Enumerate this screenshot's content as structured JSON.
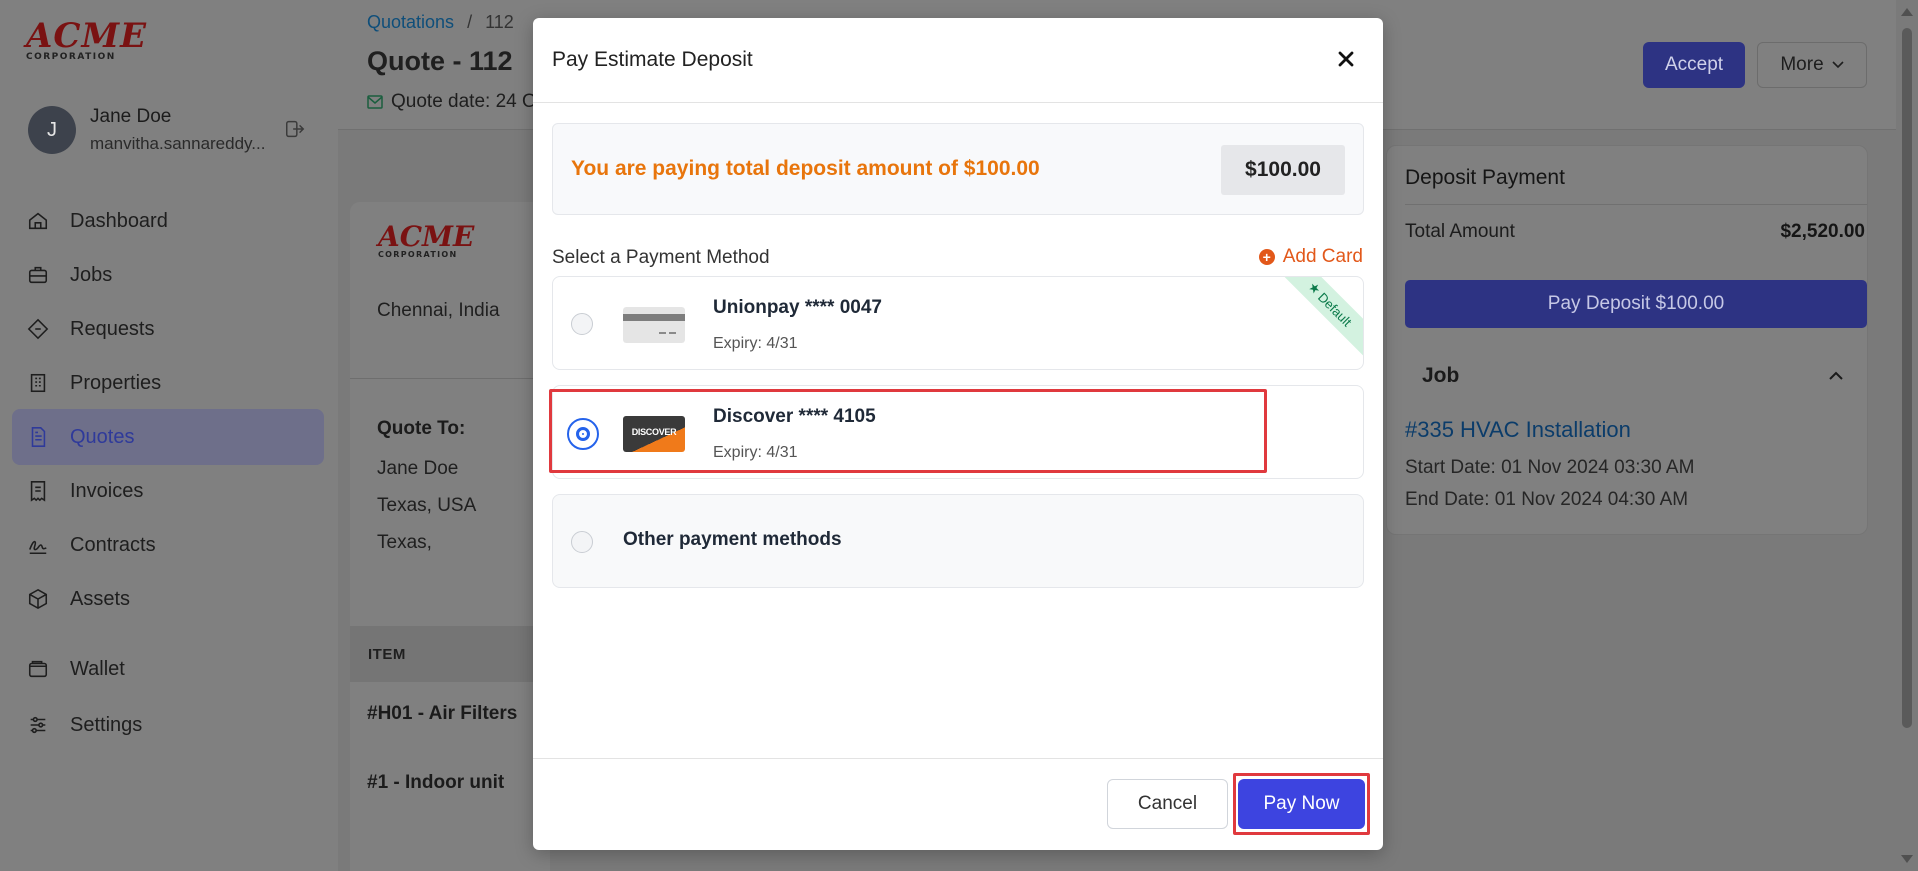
{
  "sidebar": {
    "logo": {
      "line1": "ACME",
      "line2": "CORPORATION"
    },
    "user": {
      "initial": "J",
      "name": "Jane Doe",
      "email": "manvitha.sannareddy..."
    },
    "items": [
      {
        "label": "Dashboard",
        "icon": "home-icon"
      },
      {
        "label": "Jobs",
        "icon": "briefcase-icon"
      },
      {
        "label": "Requests",
        "icon": "diamond-icon"
      },
      {
        "label": "Properties",
        "icon": "building-icon"
      },
      {
        "label": "Quotes",
        "icon": "document-icon",
        "active": true
      },
      {
        "label": "Invoices",
        "icon": "invoice-icon"
      },
      {
        "label": "Contracts",
        "icon": "signature-icon"
      },
      {
        "label": "Assets",
        "icon": "cube-icon"
      },
      {
        "label": "Wallet",
        "icon": "wallet-icon"
      },
      {
        "label": "Settings",
        "icon": "sliders-icon"
      }
    ]
  },
  "header": {
    "breadcrumb": {
      "link": "Quotations",
      "separator": "/",
      "current": "112"
    },
    "title": "Quote - 112",
    "quote_date": "Quote date: 24 O",
    "accept_label": "Accept",
    "more_label": "More"
  },
  "document": {
    "city": "Chennai, India",
    "quote_to_label": "Quote To:",
    "quote_to": [
      "Jane Doe",
      "Texas, USA",
      "Texas,"
    ],
    "item_header": "ITEM",
    "items": [
      "#H01 - Air Filters",
      "#1 - Indoor unit"
    ]
  },
  "deposit_panel": {
    "title": "Deposit Payment",
    "total_label": "Total Amount",
    "total_value": "$2,520.00",
    "pay_button": "Pay Deposit $100.00",
    "job_heading": "Job",
    "job_link": "#335 HVAC Installation",
    "start_date": "Start Date: 01 Nov 2024 03:30 AM",
    "end_date": "End Date: 01 Nov 2024 04:30 AM"
  },
  "modal": {
    "title": "Pay Estimate Deposit",
    "amount_text": "You are paying total deposit amount of $100.00",
    "amount_chip": "$100.00",
    "select_label": "Select a Payment Method",
    "add_card_label": "Add Card",
    "methods": [
      {
        "name": "Unionpay **** 0047",
        "expiry": "Expiry: 4/31",
        "badge": "Default",
        "selected": false
      },
      {
        "name": "Discover **** 4105",
        "expiry": "Expiry: 4/31",
        "card_text": "DISCOVER",
        "selected": true
      },
      {
        "name": "Other payment methods",
        "selected": false
      }
    ],
    "cancel_label": "Cancel",
    "pay_now_label": "Pay Now"
  },
  "colors": {
    "accent": "#3d44e0",
    "amount_orange": "#e8750c",
    "add_card_orange": "#e2581a",
    "radio_blue": "#2563eb",
    "highlight_red": "#e0393e",
    "default_badge_green": "#0b7a4a"
  }
}
